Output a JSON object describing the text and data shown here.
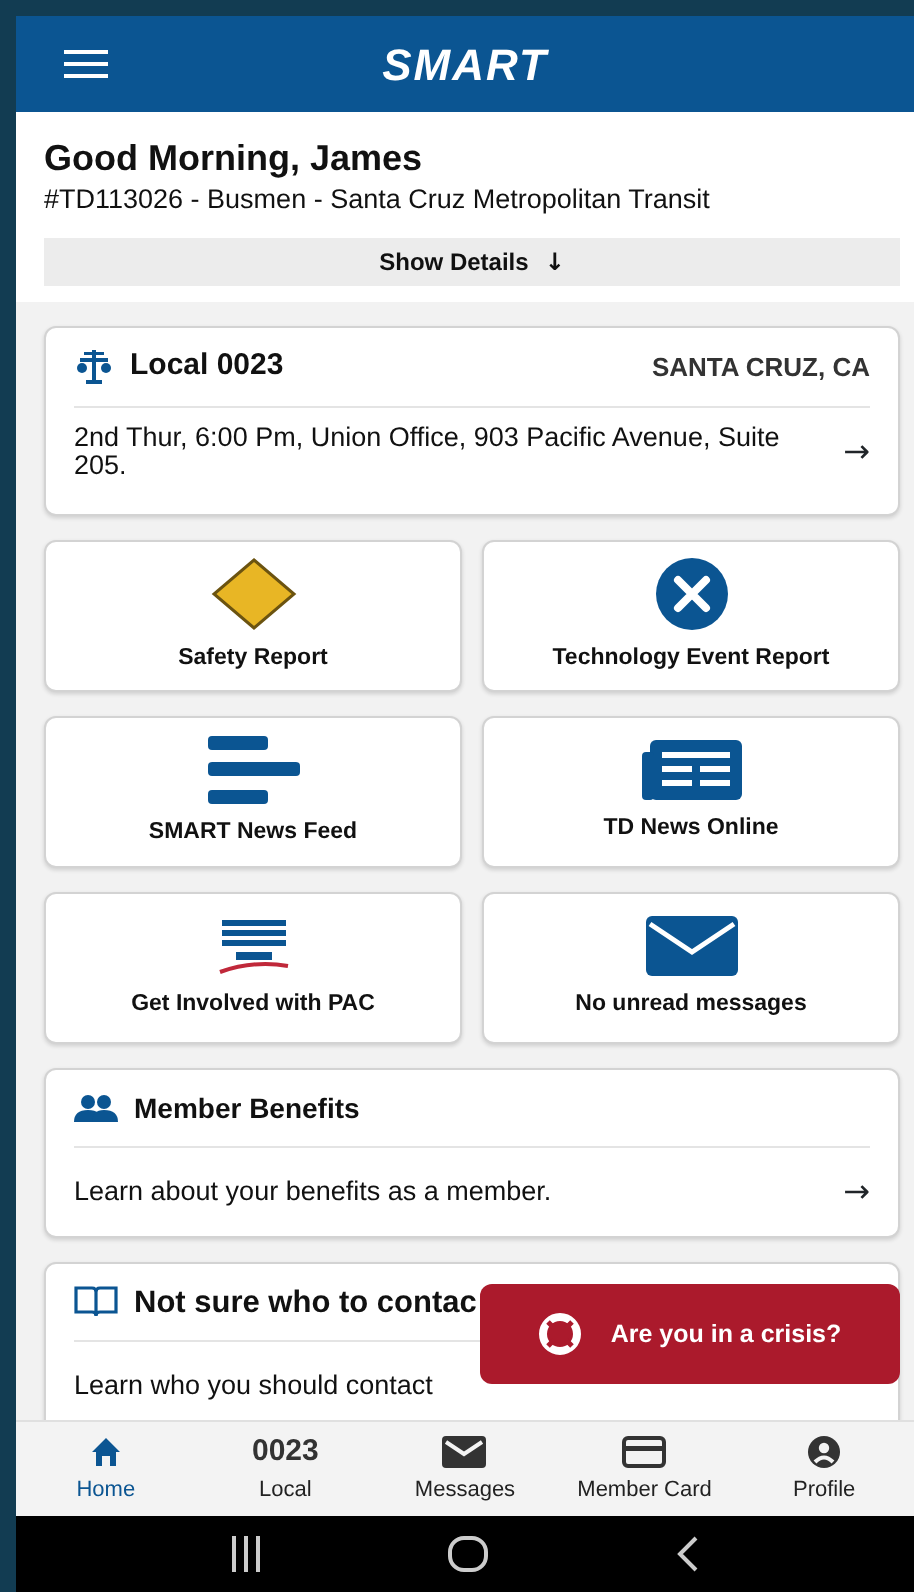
{
  "header": {
    "logo": "SMART"
  },
  "greeting": {
    "title": "Good Morning, James",
    "subtitle": "#TD113026 - Busmen - Santa Cruz Metropolitan Transit",
    "details_button": "Show Details",
    "details_arrow": "↓"
  },
  "local_card": {
    "title": "Local 0023",
    "location": "SANTA CRUZ, CA",
    "meeting": "2nd Thur, 6:00 Pm, Union Office, 903 Pacific Avenue, Suite 205.",
    "arrow": "→"
  },
  "tiles": [
    {
      "kind": "safety",
      "label": "Safety Report"
    },
    {
      "kind": "close",
      "label": "Technology Event Report"
    },
    {
      "kind": "feed",
      "label": "SMART News Feed"
    },
    {
      "kind": "newspaper",
      "label": "TD News Online"
    },
    {
      "kind": "pac",
      "label": "Get Involved with PAC"
    },
    {
      "kind": "mail",
      "label": "No unread messages"
    }
  ],
  "info_cards": [
    {
      "kind": "people",
      "title": "Member Benefits",
      "body": "Learn about your benefits as a member.",
      "arrow": "→"
    },
    {
      "kind": "book",
      "title": "Not sure who to contac",
      "body": "Learn who you should contact"
    }
  ],
  "crisis_button": {
    "label": "Are you in a crisis?"
  },
  "bottom_nav": [
    {
      "kind": "home",
      "label": "Home",
      "selected": true
    },
    {
      "kind": "number",
      "icon_text": "0023",
      "label": "Local",
      "selected": false
    },
    {
      "kind": "mail",
      "label": "Messages",
      "selected": false
    },
    {
      "kind": "card",
      "label": "Member Card",
      "selected": false
    },
    {
      "kind": "profile",
      "label": "Profile",
      "selected": false
    }
  ]
}
